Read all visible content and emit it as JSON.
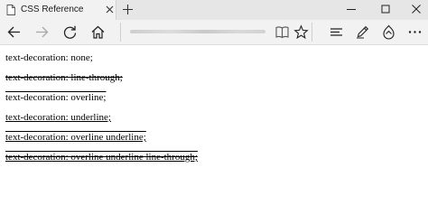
{
  "browser": {
    "tab": {
      "title": "CSS Reference",
      "favicon": "page-icon",
      "close_icon": "close-icon"
    },
    "new_tab_icon": "plus-icon",
    "window_controls": [
      "minimize-icon",
      "maximize-icon",
      "close-icon"
    ],
    "toolbar": {
      "back_icon": "arrow-left-icon",
      "forward_icon": "arrow-right-icon",
      "refresh_icon": "refresh-icon",
      "home_icon": "home-icon",
      "address_value": "",
      "reading_view_icon": "book-icon",
      "favorite_icon": "star-icon",
      "hub_icon": "hub-icon",
      "notes_icon": "pen-icon",
      "share_icon": "share-icon",
      "more_icon": "more-icon"
    },
    "colors": {
      "titlebar": "#e6e6e6",
      "active_tab": "#f2f2f2",
      "toolbar": "#f2f2f2",
      "page": "#ffffff"
    }
  },
  "page": {
    "lines": [
      {
        "text": "text-decoration: none;",
        "decoration": "none"
      },
      {
        "text": "text-decoration: line-through;",
        "decoration": "line-through"
      },
      {
        "text": "text-decoration: overline;",
        "decoration": "overline"
      },
      {
        "text": "text-decoration: underline;",
        "decoration": "underline"
      },
      {
        "text": "text-decoration: overline underline;",
        "decoration": "overline underline"
      },
      {
        "text": "text-decoration: overline underline line-through;",
        "decoration": "overline underline line-through"
      }
    ]
  }
}
